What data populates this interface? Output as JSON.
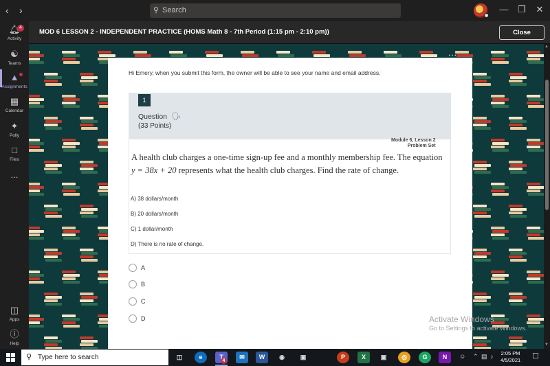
{
  "titlebar": {
    "back_icon": "chevron-left-icon",
    "forward_icon": "chevron-right-icon",
    "search_placeholder": "Search",
    "window_controls": [
      "minimize-icon",
      "maximize-icon",
      "close-icon"
    ]
  },
  "rail": {
    "items": [
      {
        "label": "Activity",
        "icon": "bell-icon",
        "badge": "4"
      },
      {
        "label": "Teams",
        "icon": "teams-icon"
      },
      {
        "label": "Assignments",
        "icon": "assignments-icon",
        "active": true
      },
      {
        "label": "Calendar",
        "icon": "calendar-icon"
      },
      {
        "label": "Polly",
        "icon": "polly-icon"
      },
      {
        "label": "Files",
        "icon": "files-icon"
      },
      {
        "label": "...",
        "icon": "more-icon"
      }
    ],
    "bottom": [
      {
        "label": "Apps",
        "icon": "apps-icon"
      },
      {
        "label": "Help",
        "icon": "help-icon"
      }
    ]
  },
  "header": {
    "title": "MOD 6 LESSON 2 - INDEPENDENT PRACTICE (HOMS Math 8 - 7th Period (1:15 pm - 2:10 pm))",
    "close_label": "Close"
  },
  "form": {
    "menu": "...",
    "notice": "Hi Emery, when you submit this form, the owner will be able to see your name and email address.",
    "question": {
      "number": "1",
      "label": "Question",
      "points": "(33 Points)",
      "image_header_line1": "Module 6, Lesson 2",
      "image_header_line2": "Problem Set",
      "text_before": "A health club charges a one-time sign-up fee and a monthly membership fee. The equation ",
      "equation": "y = 38x + 20",
      "text_after": " represents what the health club charges. Find the rate of change.",
      "image_options": [
        "A) 38 dollars/month",
        "B) 20 dollars/month",
        "C) 1 dollar/month",
        "D) There is no rate of change."
      ],
      "choices": [
        "A",
        "B",
        "C",
        "D"
      ]
    }
  },
  "watermark": {
    "line1": "Activate Windows",
    "line2": "Go to Settings to activate Windows."
  },
  "taskbar": {
    "search_placeholder": "Type here to search",
    "teams_badge": "4",
    "time": "2:05 PM",
    "date": "4/5/2021"
  },
  "colors": {
    "pattern_bg": "#0f3a3c",
    "question_number_bg": "#1e3d45",
    "accent": "#a6a7dc"
  }
}
